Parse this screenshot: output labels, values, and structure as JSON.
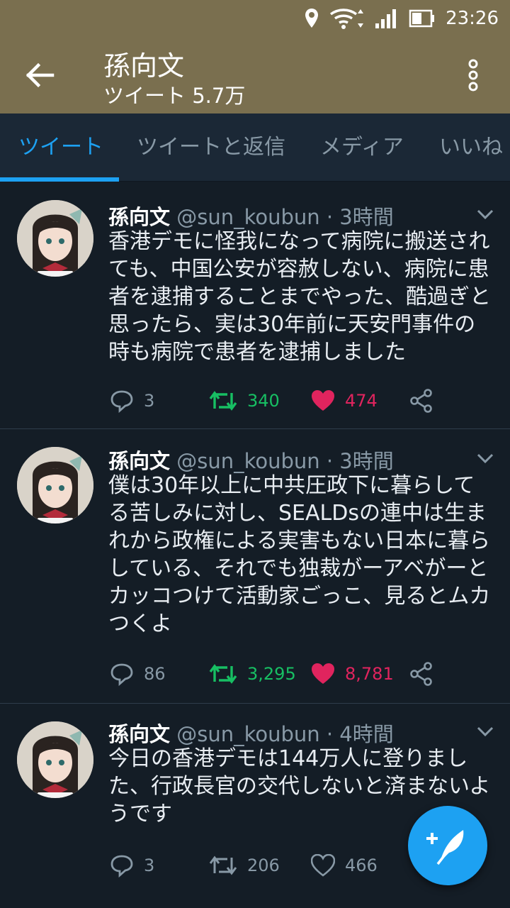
{
  "status_bar": {
    "time": "23:26"
  },
  "header": {
    "title": "孫向文",
    "subtitle": "ツイート 5.7万"
  },
  "tabs": [
    {
      "label": "ツイート"
    },
    {
      "label": "ツイートと返信"
    },
    {
      "label": "メディア"
    },
    {
      "label": "いいね"
    }
  ],
  "tweets": [
    {
      "name": "孫向文",
      "meta": "@sun_koubun · 3時間",
      "text": "香港デモに怪我になって病院に搬送されても、中国公安が容赦しない、病院に患者を逮捕することまでやった、酷過ぎと思ったら、実は30年前に天安門事件の時も病院で患者を逮捕しました",
      "replies": "3",
      "retweets": "340",
      "likes": "474",
      "retweeted": true,
      "liked": true
    },
    {
      "name": "孫向文",
      "meta": "@sun_koubun · 3時間",
      "text": "僕は30年以上に中共圧政下に暮らしてる苦しみに対し、SEALDsの連中は生まれから政権による実害もない日本に暮らしている、それでも独裁がーアベがーとカッコつけて活動家ごっこ、見るとムカつくよ",
      "replies": "86",
      "retweets": "3,295",
      "likes": "8,781",
      "retweeted": true,
      "liked": true
    },
    {
      "name": "孫向文",
      "meta": "@sun_koubun · 4時間",
      "text": "今日の香港デモは144万人に登りました、行政長官の交代しないと済まないようです",
      "replies": "3",
      "retweets": "206",
      "likes": "466",
      "retweeted": false,
      "liked": false
    }
  ],
  "icons": {
    "back": "arrow-left-icon",
    "overflow": "more-vert-icon",
    "reply": "speech-bubble-icon",
    "retweet": "retweet-icon",
    "like": "heart-icon",
    "share": "share-icon",
    "compose": "compose-tweet-icon"
  },
  "colors": {
    "header_bg": "#7a6f4f",
    "timeline_bg": "#141d26",
    "accent": "#1da1f2",
    "retweet_active": "#17bf63",
    "like_active": "#e0245e"
  }
}
